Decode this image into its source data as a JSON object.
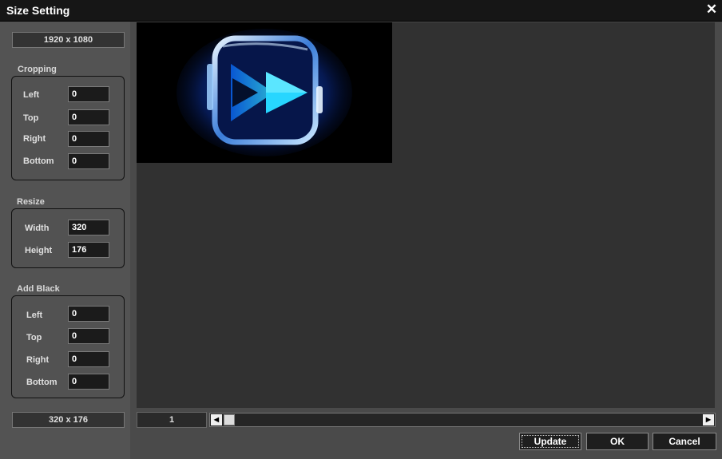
{
  "window": {
    "title": "Size Setting",
    "close_icon": "close-icon"
  },
  "source_size": "1920 x 1080",
  "cropping": {
    "label": "Cropping",
    "fields": [
      {
        "label": "Left",
        "value": "0"
      },
      {
        "label": "Top",
        "value": "0"
      },
      {
        "label": "Right",
        "value": "0"
      },
      {
        "label": "Bottom",
        "value": "0"
      }
    ]
  },
  "resize": {
    "label": "Resize",
    "fields": [
      {
        "label": "Width",
        "value": "320"
      },
      {
        "label": "Height",
        "value": "176"
      }
    ]
  },
  "add_black": {
    "label": "Add Black",
    "fields": [
      {
        "label": "Left",
        "value": "0"
      },
      {
        "label": "Top",
        "value": "0"
      },
      {
        "label": "Right",
        "value": "0"
      },
      {
        "label": "Bottom",
        "value": "0"
      }
    ]
  },
  "output_size": "320 x 176",
  "frame_number": "1",
  "buttons": {
    "update": "Update",
    "ok": "OK",
    "cancel": "Cancel"
  }
}
